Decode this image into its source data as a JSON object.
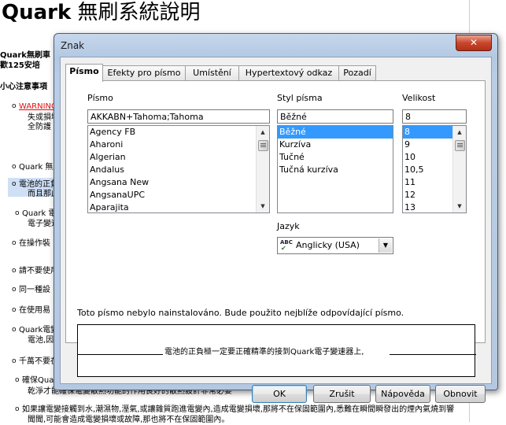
{
  "document": {
    "title_latin": "Quark",
    "title_cjk": "無刷系統說明",
    "lines": [
      {
        "text": "Quark無刷車",
        "bold": true
      },
      {
        "text": "歡125安培",
        "bold": true
      },
      {
        "text": "小心注意事項",
        "bold": true
      },
      {
        "text": "WARNING",
        "red": true
      },
      {
        "text": "失或損壞"
      },
      {
        "text": "全防護"
      },
      {
        "text": "Quark 無刷"
      },
      {
        "text": "電池的正負"
      },
      {
        "text": "而且那此"
      },
      {
        "text": "Quark 電"
      },
      {
        "text": "電子變速"
      },
      {
        "text": "在操作裝"
      },
      {
        "text": "請不要使用"
      },
      {
        "text": "同一種設"
      },
      {
        "text": "在使用易"
      },
      {
        "text": "Quark電變"
      },
      {
        "text": "電池,因"
      },
      {
        "text": "千萬不要在"
      },
      {
        "text": "確保Quar"
      },
      {
        "text": "乾淨才能確保電變散熱功能的作用良好的散熱設計非常必要"
      },
      {
        "text": "如果讓電變接觸到水,潮濕物,溼氣,或讓雜質跑進電變內,造成電變損壞,那將不在保固範圍內,悉難在瞬間瞬發出的煙內氣燒到響"
      },
      {
        "text": "聞聞,可能會造成電變損壞或故障,那也將不在保固範圍內。"
      }
    ]
  },
  "dialog": {
    "title": "Znak",
    "close_label": "✕",
    "tabs": [
      "Písmo",
      "Efekty pro písmo",
      "Umístění",
      "Hypertextový odkaz",
      "Pozadí"
    ],
    "active_tab": 0,
    "font": {
      "label": "Písmo",
      "value": "AKKABN+Tahoma;Tahoma",
      "options": [
        "Agency FB",
        "Aharoni",
        "Algerian",
        "Andalus",
        "Angsana New",
        "AngsanaUPC",
        "Aparajita"
      ]
    },
    "style": {
      "label": "Styl písma",
      "value": "Běžné",
      "options": [
        "Běžné",
        "Kurzíva",
        "Tučné",
        "Tučná kurzíva"
      ],
      "selected": 0
    },
    "size": {
      "label": "Velikost",
      "value": "8",
      "options": [
        "8",
        "9",
        "10",
        "10,5",
        "11",
        "12",
        "13"
      ],
      "selected": 0
    },
    "language": {
      "label": "Jazyk",
      "value": "Anglicky (USA)",
      "icon_text": "ABC"
    },
    "note": "Toto písmo nebylo nainstalováno. Bude použito nejblíže odpovídající písmo.",
    "preview_text": "電池的正負極一定要正確精準的接到Quark電子變速器上,",
    "buttons": {
      "ok": "OK",
      "cancel": "Zrušit",
      "help": "Nápověda",
      "reset": "Obnovit"
    }
  }
}
